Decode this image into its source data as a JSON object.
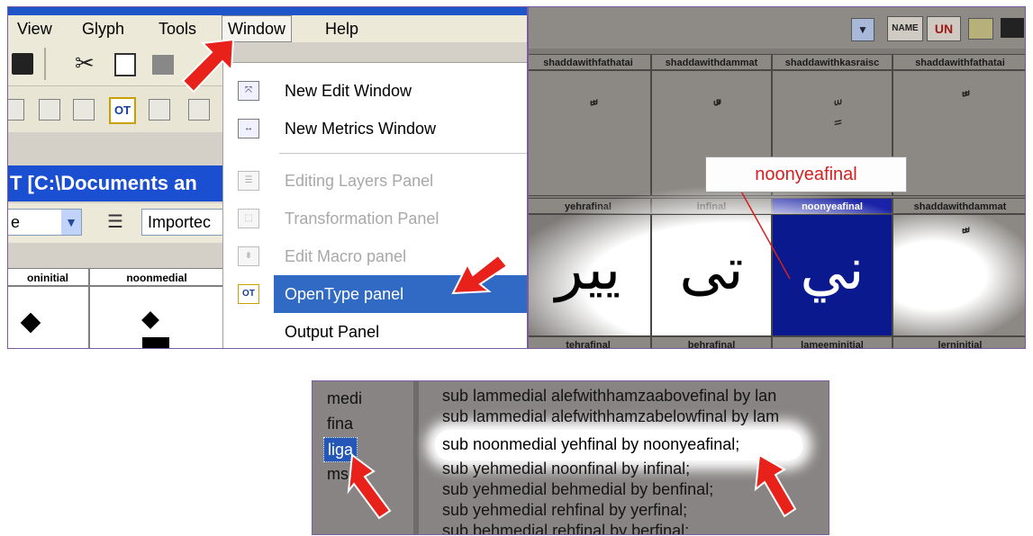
{
  "menu": {
    "items": [
      "View",
      "Glyph",
      "Tools",
      "Window",
      "Help"
    ],
    "open_item": "Window"
  },
  "window_menu": {
    "items": [
      {
        "label": "New Edit Window",
        "icon": "edit-window-icon",
        "state": "enabled"
      },
      {
        "label": "New Metrics Window",
        "icon": "metrics-window-icon",
        "state": "enabled"
      },
      {
        "label": "Editing Layers Panel",
        "icon": "layers-panel-icon",
        "state": "disabled"
      },
      {
        "label": "Transformation Panel",
        "icon": "transformation-panel-icon",
        "state": "disabled"
      },
      {
        "label": "Edit Macro panel",
        "icon": "macro-panel-icon",
        "state": "disabled"
      },
      {
        "label": "OpenType panel",
        "icon": "opentype-panel-icon",
        "state": "selected",
        "icon_text": "OT"
      },
      {
        "label": "Output Panel",
        "icon": "",
        "state": "enabled"
      }
    ]
  },
  "font_window": {
    "title_fragment": "T [C:\\Documents an",
    "combo_left": "e",
    "combo_right": "Importec",
    "glyph_headers": [
      "oninitial",
      "noonmedial"
    ],
    "toolbar_ot_label": "OT"
  },
  "glyph_grid": {
    "row1_headers": [
      "shaddawithfathatai",
      "shaddawithdammat",
      "shaddawithkasraisc",
      "shaddawithfathatai"
    ],
    "row2_headers": [
      "yehrafinal",
      "infinal",
      "noonyeafinal",
      "shaddawithdammat"
    ],
    "row3_headers": [
      "tehrafinal",
      "behrafinal",
      "lameeminitial",
      "lerninitial"
    ],
    "row2_glyphs": [
      "يير",
      "تى",
      "ني",
      "ًّ"
    ],
    "selected_glyph": "noonyeafinal",
    "callout": "noonyeafinal",
    "toolbar_badges": [
      "NAME",
      "UN"
    ]
  },
  "opentype_panel": {
    "features": [
      "medi",
      "fina",
      "liga",
      "mse"
    ],
    "selected_feature": "liga",
    "rules": [
      "sub lammedial alefwithhamzaabovefinal by lan",
      "sub lammedial alefwithhamzabelowfinal by lam",
      "sub noonmedial yehfinal by noonyeafinal;",
      "sub yehmedial noonfinal by infinal;",
      "sub yehmedial behmedial by benfinal;",
      "sub yehmedial rehfinal by yerfinal;",
      "sub behmedial rehfinal by berfinal;"
    ],
    "highlighted_rule": 2
  },
  "colors": {
    "highlight": "#316ac5",
    "annotation_arrow": "#e8211a",
    "callout_text": "#d42020"
  }
}
